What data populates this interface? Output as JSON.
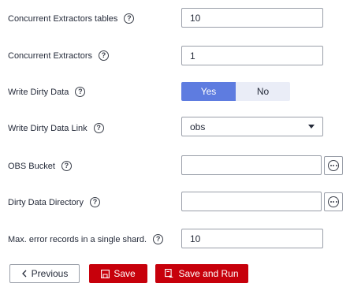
{
  "fields": {
    "concurrent_tables": {
      "label": "Concurrent Extractors tables",
      "value": "10"
    },
    "concurrent_extractors": {
      "label": "Concurrent Extractors",
      "value": "1"
    },
    "write_dirty_data": {
      "label": "Write Dirty Data",
      "options": [
        "Yes",
        "No"
      ],
      "selected": "Yes"
    },
    "write_dirty_data_link": {
      "label": "Write Dirty Data Link",
      "value": "obs"
    },
    "obs_bucket": {
      "label": "OBS Bucket",
      "value": ""
    },
    "dirty_data_directory": {
      "label": "Dirty Data Directory",
      "value": ""
    },
    "max_error_records": {
      "label": "Max. error records in a single shard.",
      "value": "10"
    }
  },
  "help_glyph": "?",
  "buttons": {
    "previous": "Previous",
    "save": "Save",
    "save_and_run": "Save and Run"
  },
  "colors": {
    "accent": "#5e7ce0",
    "accent_light": "#eaedf7",
    "danger": "#c7000b",
    "border": "#9a9fa9"
  }
}
